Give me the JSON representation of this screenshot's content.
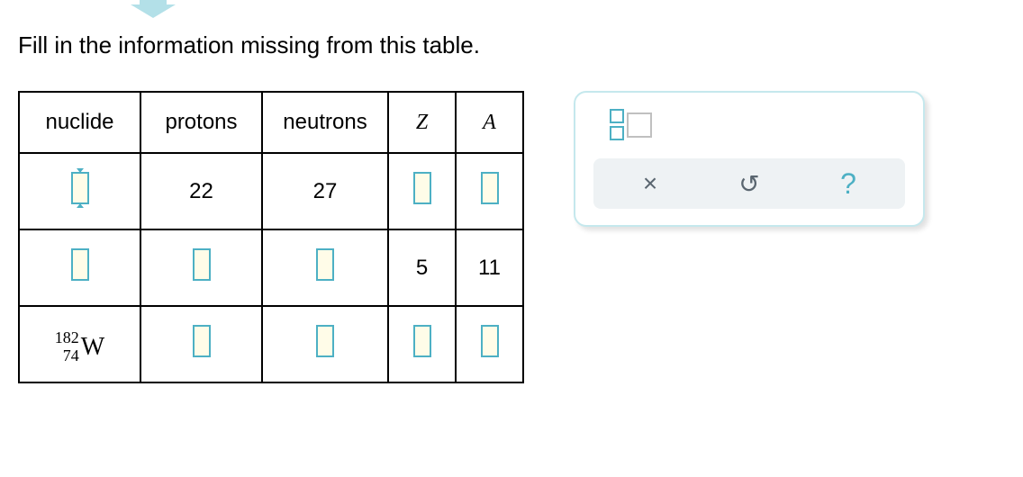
{
  "instruction": "Fill in the information missing from this table.",
  "headers": {
    "nuclide": "nuclide",
    "protons": "protons",
    "neutrons": "neutrons",
    "z": "Z",
    "a": "A"
  },
  "rows": [
    {
      "nuclide_input": true,
      "nuclide_active": true,
      "protons": "22",
      "protons_input": false,
      "neutrons": "27",
      "neutrons_input": false,
      "z": "",
      "z_input": true,
      "a": "",
      "a_input": true
    },
    {
      "nuclide_input": true,
      "nuclide_active": false,
      "protons": "",
      "protons_input": true,
      "neutrons": "",
      "neutrons_input": true,
      "z": "5",
      "z_input": false,
      "a": "11",
      "a_input": false
    },
    {
      "nuclide_mass": "182",
      "nuclide_atomic": "74",
      "nuclide_symbol": "W",
      "nuclide_input": false,
      "protons": "",
      "protons_input": true,
      "neutrons": "",
      "neutrons_input": true,
      "z": "",
      "z_input": true,
      "a": "",
      "a_input": true
    }
  ],
  "actions": {
    "clear": "×",
    "undo": "↺",
    "help": "?"
  }
}
